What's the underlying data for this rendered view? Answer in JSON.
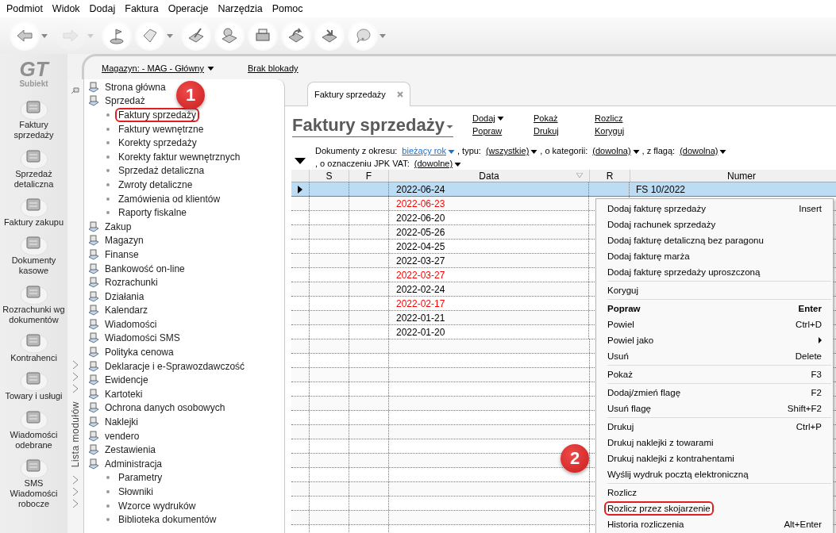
{
  "menu_bar": [
    "Podmiot",
    "Widok",
    "Dodaj",
    "Faktura",
    "Operacje",
    "Narzędzia",
    "Pomoc"
  ],
  "toolbar": [
    {
      "dropdown": true,
      "disabled": false
    },
    {
      "dropdown": true,
      "disabled": true
    },
    {
      "dropdown": false,
      "disabled": false
    },
    {
      "dropdown": true,
      "disabled": false
    },
    {
      "dropdown": false,
      "disabled": false
    },
    {
      "dropdown": false,
      "disabled": false
    },
    {
      "dropdown": false,
      "disabled": false
    },
    {
      "dropdown": false,
      "disabled": false
    },
    {
      "dropdown": false,
      "disabled": false
    },
    {
      "dropdown": true,
      "disabled": false
    }
  ],
  "logo": {
    "mark": "GT",
    "name": "Subiekt"
  },
  "modules": [
    "Faktury sprzedaży",
    "Sprzedaż detaliczna",
    "Faktury zakupu",
    "Dokumenty kasowe",
    "Rozrachunki wg dokumentów",
    "Kontrahenci",
    "Towary i usługi",
    "Wiadomości odebrane",
    "SMS Wiadomości robocze"
  ],
  "top_strip": {
    "warehouse": "Magazyn: - MAG - Główny",
    "lock": "Brak blokady"
  },
  "side_label": "Lista modułów",
  "tree": [
    {
      "label": "Strona główna"
    },
    {
      "label": "Sprzedaż",
      "children": [
        {
          "label": "Faktury sprzedaży",
          "highlighted": true
        },
        {
          "label": "Faktury wewnętrzne",
          "highlighted": false
        },
        {
          "label": "Korekty sprzedaży",
          "highlighted": false
        },
        {
          "label": "Korekty faktur wewnętrznych",
          "highlighted": false
        },
        {
          "label": "Sprzedaż detaliczna",
          "highlighted": false
        },
        {
          "label": "Zwroty detaliczne",
          "highlighted": false
        },
        {
          "label": "Zamówienia od klientów",
          "highlighted": false
        },
        {
          "label": "Raporty fiskalne",
          "highlighted": false
        }
      ]
    },
    {
      "label": "Zakup"
    },
    {
      "label": "Magazyn"
    },
    {
      "label": "Finanse"
    },
    {
      "label": "Bankowość on-line"
    },
    {
      "label": "Rozrachunki"
    },
    {
      "label": "Działania"
    },
    {
      "label": "Kalendarz"
    },
    {
      "label": "Wiadomości"
    },
    {
      "label": "Wiadomości SMS"
    },
    {
      "label": "Polityka cenowa"
    },
    {
      "label": "Deklaracje i e-Sprawozdawczość"
    },
    {
      "label": "Ewidencje"
    },
    {
      "label": "Kartoteki"
    },
    {
      "label": "Ochrona danych osobowych"
    },
    {
      "label": "Naklejki"
    },
    {
      "label": "vendero"
    },
    {
      "label": "Zestawienia"
    },
    {
      "label": "Administracja",
      "children": [
        {
          "label": "Parametry",
          "highlighted": false
        },
        {
          "label": "Słowniki",
          "highlighted": false
        },
        {
          "label": "Wzorce wydruków",
          "highlighted": false
        },
        {
          "label": "Biblioteka dokumentów",
          "highlighted": false
        }
      ]
    }
  ],
  "tab": {
    "label": "Faktury sprzedaży"
  },
  "title": "Faktury sprzedaży",
  "actions": [
    [
      {
        "label": "Dodaj",
        "dropdown": true
      },
      {
        "label": "Popraw",
        "dropdown": false
      }
    ],
    [
      {
        "label": "Pokaż",
        "dropdown": false
      },
      {
        "label": "Drukuj",
        "dropdown": false
      }
    ],
    [
      {
        "label": "Rozlicz",
        "dropdown": false
      },
      {
        "label": "Koryguj",
        "dropdown": false
      }
    ]
  ],
  "filters": [
    {
      "label": "Dokumenty z okresu:",
      "value": "bieżący rok",
      "highlighted": true
    },
    {
      "label": ", typu:",
      "value": "(wszystkie)",
      "highlighted": false
    },
    {
      "label": ", o kategorii:",
      "value": "(dowolna)",
      "highlighted": false
    },
    {
      "label": ", z flagą:",
      "value": "(dowolna)",
      "highlighted": false
    },
    {
      "label": ", o oznaczeniu JPK VAT:",
      "value": "(dowolne)",
      "highlighted": false
    }
  ],
  "table": {
    "columns": [
      "S",
      "F",
      "Data",
      "R",
      "Numer"
    ],
    "rows": [
      {
        "date": "2022-06-24",
        "number": "FS 10/2022",
        "color": "#000000",
        "selected": true
      },
      {
        "date": "2022-06-23",
        "color": "#ff0000",
        "selected": false
      },
      {
        "date": "2022-06-20",
        "color": "#000000",
        "selected": false
      },
      {
        "date": "2022-05-26",
        "color": "#000000",
        "selected": false
      },
      {
        "date": "2022-04-25",
        "color": "#000000",
        "selected": false
      },
      {
        "date": "2022-03-27",
        "color": "#000000",
        "selected": false
      },
      {
        "date": "2022-03-27",
        "color": "#ff0000",
        "selected": false
      },
      {
        "date": "2022-02-24",
        "color": "#000000",
        "selected": false
      },
      {
        "date": "2022-02-17",
        "color": "#ff0000",
        "selected": false
      },
      {
        "date": "2022-01-21",
        "color": "#000000",
        "selected": false
      },
      {
        "date": "2022-01-20",
        "color": "#000000",
        "selected": false
      }
    ]
  },
  "context_menu": [
    [
      {
        "label": "Dodaj fakturę sprzedaży",
        "shortcut": "Insert"
      },
      {
        "label": "Dodaj rachunek sprzedaży"
      },
      {
        "label": "Dodaj fakturę detaliczną bez paragonu"
      },
      {
        "label": "Dodaj fakturę marża"
      },
      {
        "label": "Dodaj fakturę sprzedaży uproszczoną"
      }
    ],
    [
      {
        "label": "Koryguj"
      }
    ],
    [
      {
        "label": "Popraw",
        "shortcut": "Enter",
        "bold": true
      },
      {
        "label": "Powiel",
        "shortcut": "Ctrl+D"
      },
      {
        "label": "Powiel jako",
        "submenu": true
      },
      {
        "label": "Usuń",
        "shortcut": "Delete"
      }
    ],
    [
      {
        "label": "Pokaż",
        "shortcut": "F3"
      }
    ],
    [
      {
        "label": "Dodaj/zmień flagę",
        "shortcut": "F2"
      },
      {
        "label": "Usuń flagę",
        "shortcut": "Shift+F2"
      }
    ],
    [
      {
        "label": "Drukuj",
        "shortcut": "Ctrl+P"
      },
      {
        "label": "Drukuj naklejki z towarami"
      },
      {
        "label": "Drukuj naklejki z kontrahentami"
      },
      {
        "label": "Wyślij wydruk pocztą elektroniczną"
      }
    ],
    [
      {
        "label": "Rozlicz"
      },
      {
        "label": "Rozlicz przez skojarzenie",
        "highlighted": true
      },
      {
        "label": "Historia rozliczenia",
        "shortcut": "Alt+Enter"
      }
    ]
  ],
  "step_badges": [
    "1",
    "2"
  ]
}
